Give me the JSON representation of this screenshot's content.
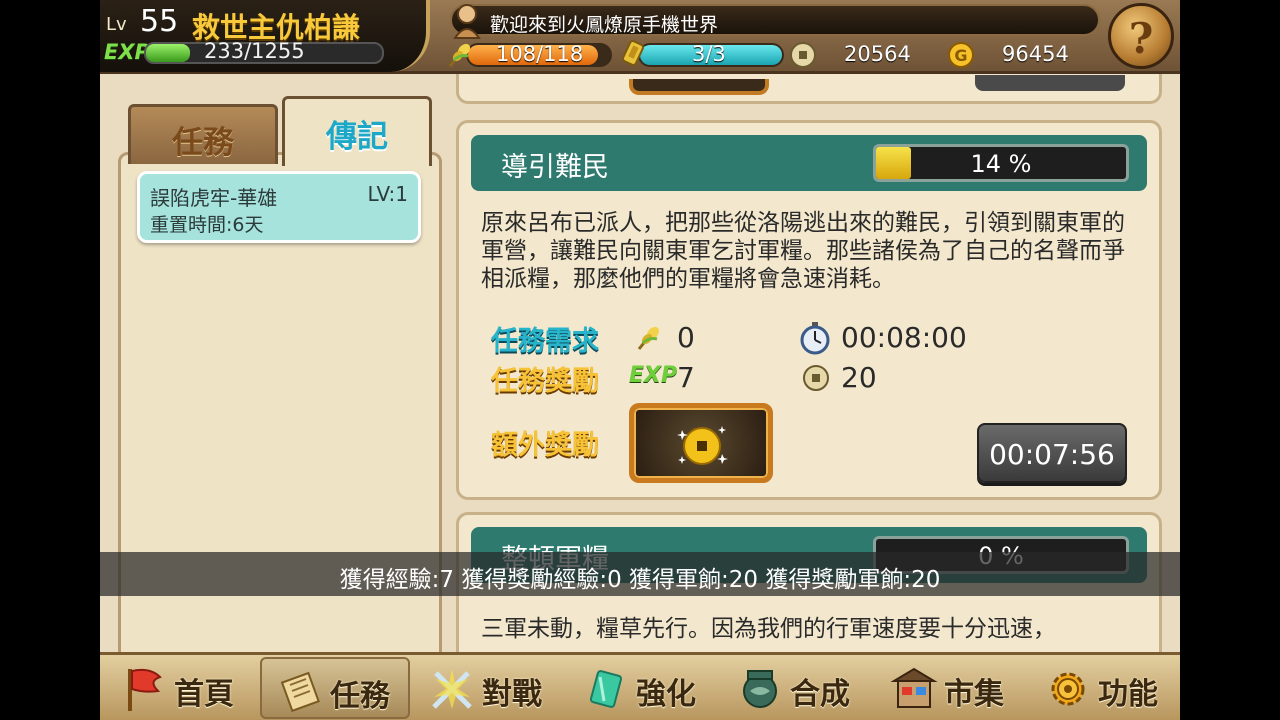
{
  "player": {
    "lv_label": "Lv",
    "level": "55",
    "name": "救世主仇柏謙",
    "exp_label": "EXP",
    "exp_text": "233/1255",
    "exp_fraction": 0.186
  },
  "marquee": {
    "text": "歡迎來到火鳳燎原手機世界"
  },
  "resources": {
    "food": {
      "text": "108/118",
      "fraction": 0.915,
      "icon": "grain-icon",
      "color": "#f08a1c"
    },
    "tokens": {
      "text": "3/3",
      "fraction": 1.0,
      "icon": "token-icon",
      "color": "#2cc6cc"
    },
    "coins": {
      "text": "20564",
      "icon": "copper-coin-icon"
    },
    "gold": {
      "text": "96454",
      "icon": "gold-coin-icon"
    }
  },
  "help": {
    "label": "?"
  },
  "tabs": [
    {
      "label": "任務",
      "active": false
    },
    {
      "label": "傳記",
      "active": true
    }
  ],
  "quest_list": [
    {
      "name": "誤陷虎牢-華雄",
      "lv": "LV:1",
      "reset": "重置時間:6天"
    }
  ],
  "main_card": {
    "title": "導引難民",
    "progress_text": "14 %",
    "progress": 0.14,
    "description": "原來呂布已派人，把那些從洛陽逃出來的難民，引領到關東軍的軍營，讓難民向關東軍乞討軍糧。那些諸侯為了自己的名聲而爭相派糧，那麼他們的軍糧將會急速消耗。",
    "req_label": "任務需求",
    "req_food": "0",
    "req_time": "00:08:00",
    "reward_label": "任務獎勵",
    "exp_label": "EXP",
    "reward_exp": "7",
    "reward_coin": "20",
    "extra_label": "額外獎勵",
    "timer_button": "00:07:56"
  },
  "next_card": {
    "title": "整頓軍糧",
    "progress_text": "0 %",
    "progress": 0,
    "description": "三軍未動，糧草先行。因為我們的行軍速度要十分迅速，"
  },
  "toast": {
    "text": "獲得經驗:7 獲得獎勵經驗:0 獲得軍餉:20 獲得獎勵軍餉:20"
  },
  "nav": [
    {
      "label": "首頁",
      "icon": "flag-icon",
      "active": false
    },
    {
      "label": "任務",
      "icon": "scroll-icon",
      "active": true
    },
    {
      "label": "對戰",
      "icon": "crossed-swords-icon",
      "active": false
    },
    {
      "label": "強化",
      "icon": "crystal-icon",
      "active": false
    },
    {
      "label": "合成",
      "icon": "bronze-vessel-icon",
      "active": false
    },
    {
      "label": "市集",
      "icon": "market-stall-icon",
      "active": false
    },
    {
      "label": "功能",
      "icon": "gear-icon",
      "active": false
    }
  ]
}
